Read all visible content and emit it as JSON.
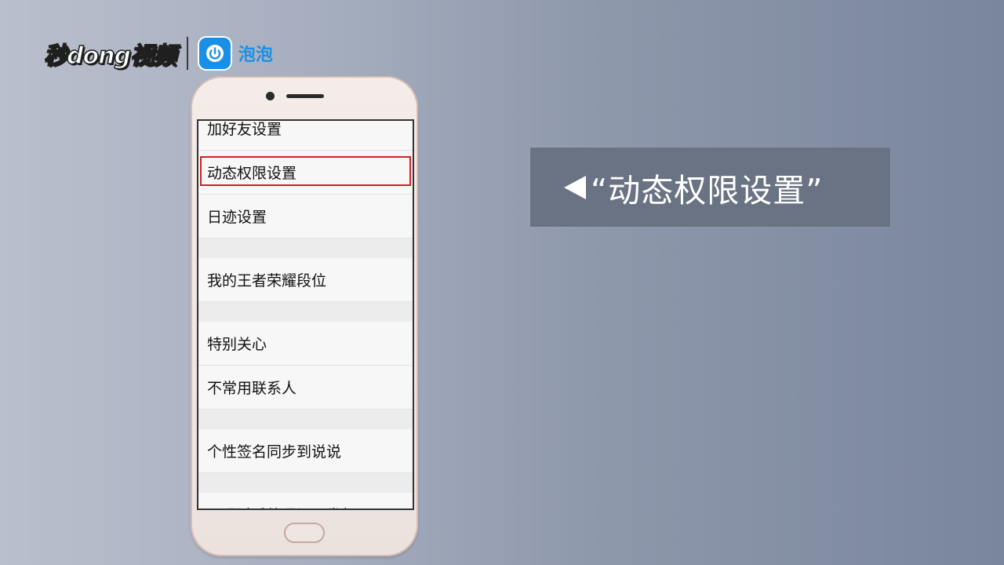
{
  "brand": {
    "logo_text": "秒dong视频",
    "app_name": "泡泡",
    "app_icon": "power-bubble-icon",
    "app_color": "#1a8fe6"
  },
  "phone": {
    "settings_items": [
      "加好友设置",
      "动态权限设置",
      "日迹设置",
      "我的王者荣耀段位",
      "特别关心",
      "不常用联系人",
      "个性签名同步到说说",
      "可通过系统通讯录发起QQ..."
    ],
    "highlighted_item": "动态权限设置",
    "highlight_color": "#d11f2a"
  },
  "callout": {
    "arrow_icon": "left-triangle-icon",
    "text": "“动态权限设置”"
  }
}
